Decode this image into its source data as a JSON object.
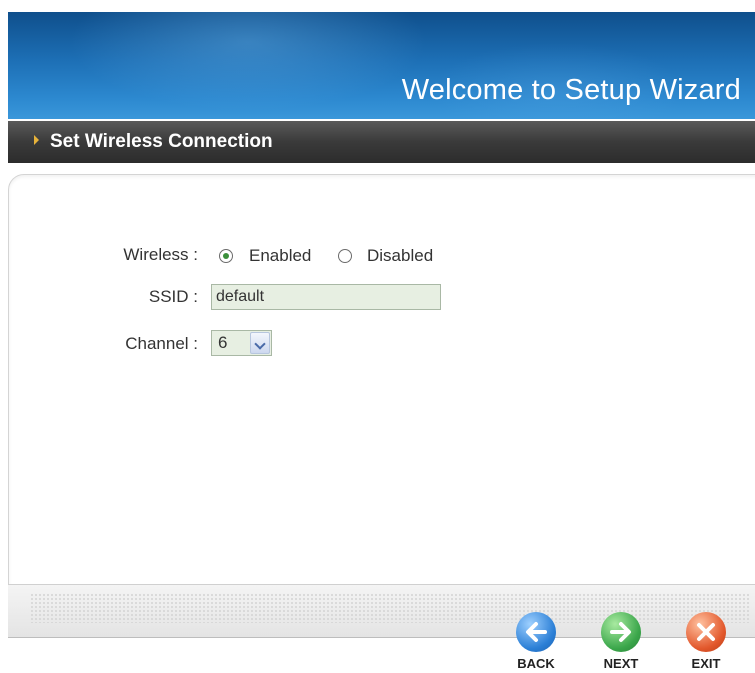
{
  "header": {
    "title": "Welcome to Setup Wizard"
  },
  "section": {
    "title": "Set Wireless Connection"
  },
  "form": {
    "wireless": {
      "label": "Wireless :",
      "options": [
        "Enabled",
        "Disabled"
      ],
      "selected": "Enabled"
    },
    "ssid": {
      "label": "SSID :",
      "value": "default"
    },
    "channel": {
      "label": "Channel :",
      "value": "6"
    }
  },
  "buttons": {
    "back": "BACK",
    "next": "NEXT",
    "exit": "EXIT"
  },
  "icons": {
    "back": "back-arrow-icon",
    "next": "next-arrow-icon",
    "exit": "close-x-icon"
  },
  "colors": {
    "back": "#2b7fd6",
    "next": "#3aa64a",
    "exit": "#e2572b"
  }
}
